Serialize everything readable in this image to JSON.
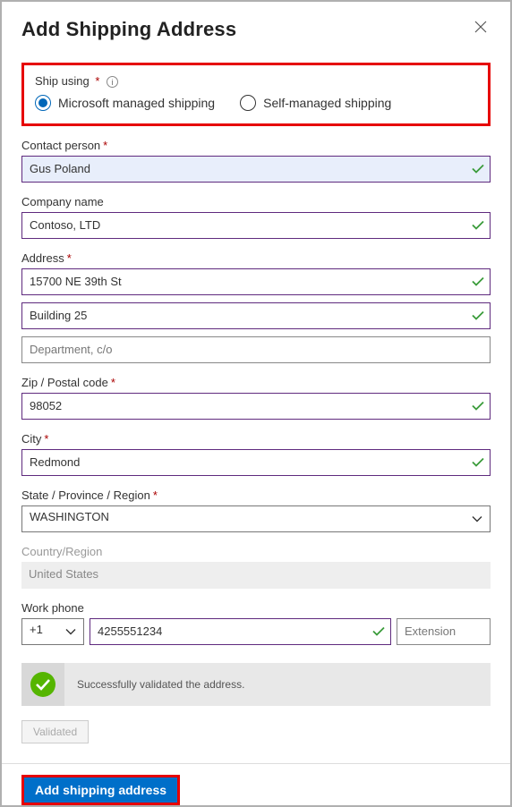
{
  "header": {
    "title": "Add Shipping Address"
  },
  "shipUsing": {
    "label": "Ship using",
    "options": {
      "managed": "Microsoft managed shipping",
      "self": "Self-managed shipping"
    }
  },
  "contactPerson": {
    "label": "Contact person",
    "value": "Gus Poland"
  },
  "companyName": {
    "label": "Company name",
    "value": "Contoso, LTD"
  },
  "address": {
    "label": "Address",
    "line1": "15700 NE 39th St",
    "line2": "Building 25",
    "line3placeholder": "Department, c/o"
  },
  "zip": {
    "label": "Zip / Postal code",
    "value": "98052"
  },
  "city": {
    "label": "City",
    "value": "Redmond"
  },
  "state": {
    "label": "State / Province / Region",
    "value": "WASHINGTON"
  },
  "country": {
    "label": "Country/Region",
    "value": "United States"
  },
  "workPhone": {
    "label": "Work phone",
    "code": "+1",
    "number": "4255551234",
    "extPlaceholder": "Extension"
  },
  "validation": {
    "message": "Successfully validated the address.",
    "buttonLabel": "Validated"
  },
  "footer": {
    "submitLabel": "Add shipping address"
  }
}
